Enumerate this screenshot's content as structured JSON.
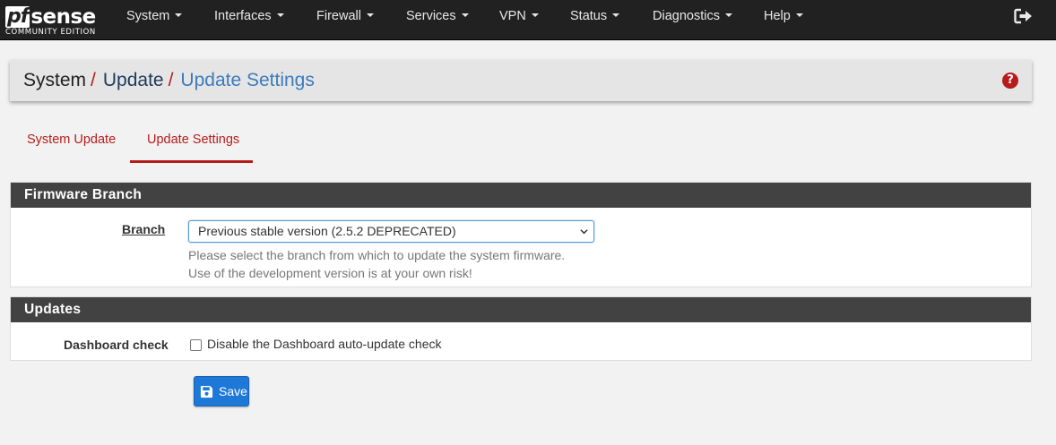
{
  "brand": {
    "logo_prefix": "pf",
    "logo_suffix": "sense",
    "edition": "COMMUNITY EDITION"
  },
  "nav": {
    "items": [
      {
        "label": "System"
      },
      {
        "label": "Interfaces"
      },
      {
        "label": "Firewall"
      },
      {
        "label": "Services"
      },
      {
        "label": "VPN"
      },
      {
        "label": "Status"
      },
      {
        "label": "Diagnostics"
      },
      {
        "label": "Help"
      }
    ],
    "logout_icon": "sign-out-icon"
  },
  "breadcrumb": {
    "items": [
      "System",
      "Update",
      "Update Settings"
    ],
    "separator": "/",
    "help_icon": "question-circle-icon",
    "help_symbol": "?"
  },
  "tabs": [
    {
      "label": "System Update",
      "active": false
    },
    {
      "label": "Update Settings",
      "active": true
    }
  ],
  "firmware_panel": {
    "title": "Firmware Branch",
    "branch_label": "Branch",
    "branch_selected": "Previous stable version (2.5.2 DEPRECATED)",
    "help_line1": "Please select the branch from which to update the system firmware.",
    "help_line2": "Use of the development version is at your own risk!"
  },
  "updates_panel": {
    "title": "Updates",
    "dashboard_label": "Dashboard check",
    "dashboard_checkbox_label": "Disable the Dashboard auto-update check",
    "dashboard_checked": false
  },
  "save_button": {
    "label": "Save",
    "icon": "save-icon"
  },
  "colors": {
    "navbar": "#212121",
    "accent_red": "#b71c1c",
    "link_blue": "#3c7bbd",
    "panel_heading": "#424242",
    "button_primary": "#1e78d8"
  }
}
